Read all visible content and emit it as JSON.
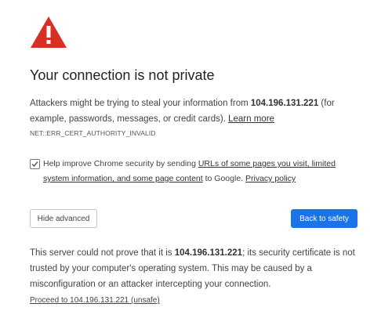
{
  "page": {
    "icon": "warning-triangle-icon",
    "title": "Your connection is not private",
    "desc_part1": "Attackers might be trying to steal your information from ",
    "host": "104.196.131.221",
    "desc_part2": " (for example, passwords, messages, or credit cards). ",
    "learn_more": "Learn more",
    "error_code": "NET::ERR_CERT_AUTHORITY_INVALID"
  },
  "checkbox": {
    "checked": true,
    "text_before": "Help improve Chrome security by sending ",
    "link_text": "URLs of some pages you visit, limited system information, and some page content",
    "text_after": " to Google. ",
    "privacy_link": "Privacy policy"
  },
  "buttons": {
    "hide_advanced": "Hide advanced",
    "back_to_safety": "Back to safety"
  },
  "details": {
    "part1": "This server could not prove that it is ",
    "host": "104.196.131.221",
    "part2": "; its security certificate is not trusted by your computer's operating system. This may be caused by a misconfiguration or an attacker intercepting your connection."
  },
  "proceed_link": "Proceed to 104.196.131.221 (unsafe)",
  "colors": {
    "warning_red": "#d93025",
    "primary_blue": "#1b73e8",
    "text": "#444444"
  }
}
